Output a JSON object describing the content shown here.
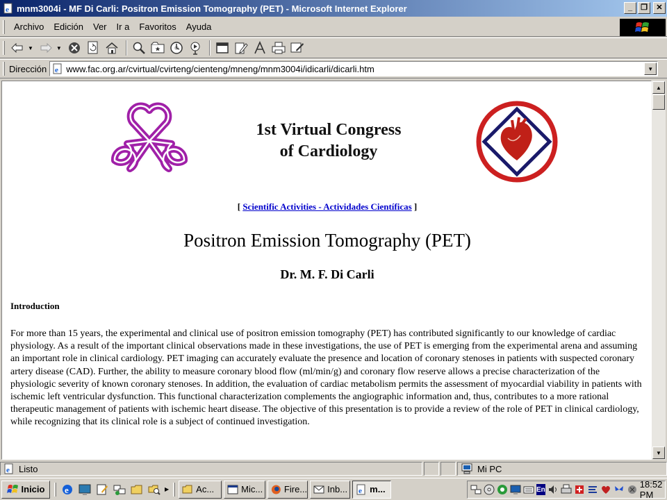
{
  "window": {
    "title": "mnm3004i - MF Di Carli: Positron Emission Tomography (PET) - Microsoft Internet Explorer",
    "buttons": {
      "minimize": "_",
      "maximize": "❐",
      "close": "✕"
    }
  },
  "menu": {
    "items": [
      "Archivo",
      "Edición",
      "Ver",
      "Ir a",
      "Favoritos",
      "Ayuda"
    ]
  },
  "toolbar": {
    "icons": [
      "back-icon",
      "forward-icon",
      "stop-icon",
      "refresh-icon",
      "home-icon",
      "search-icon",
      "favorites-icon",
      "history-icon",
      "media-icon",
      "fullscreen-icon",
      "edit-icon",
      "mail-icon",
      "print-icon",
      "discuss-icon"
    ]
  },
  "address": {
    "label": "Dirección",
    "url": "www.fac.org.ar/cvirtual/cvirteng/cienteng/mneng/mnm3004i/idicarli/dicarli.htm"
  },
  "page": {
    "congress_title_line1": "1st Virtual Congress",
    "congress_title_line2": "of Cardiology",
    "nav_prefix": "[",
    "nav_link": "Scientific Activities - Actividades Científicas",
    "nav_suffix": "]",
    "title": "Positron Emission Tomography (PET)",
    "author": "Dr. M. F. Di Carli",
    "section_heading": "Introduction",
    "paragraph": "For more than 15 years, the experimental and clinical use of positron emission tomography (PET) has contributed significantly to our knowledge of cardiac physiology. As a result of the important clinical observations made in these investigations, the use of PET is emerging from the experimental arena and assuming an important role in clinical cardiology. PET imaging can accurately evaluate the presence and location of coronary stenoses in patients with suspected coronary artery disease (CAD). Further, the ability to measure coronary blood flow (ml/min/g) and coronary flow reserve allows a precise characterization of the physiologic severity of known coronary stenoses. In addition, the evaluation of cardiac metabolism permits the assessment of myocardial viability in patients with ischemic left ventricular dysfunction. This functional characterization complements the angiographic information and, thus, contributes to a more rational therapeutic management of patients with ischemic heart disease. The objective of this presentation is to provide a review of the role of PET in clinical cardiology, while recognizing that its clinical role is a subject of continued investigation."
  },
  "status": {
    "text": "Listo",
    "zone": "Mi PC"
  },
  "taskbar": {
    "start": "Inicio",
    "tasks": [
      "Ac...",
      "Mic...",
      "Fire...",
      "Inb...",
      "m..."
    ],
    "clock": "18:52 PM",
    "language": "En"
  },
  "colors": {
    "link": "#0000cc",
    "logo_purple": "#a020a8",
    "logo_red": "#cc2020",
    "logo_navy": "#1a1a6a"
  }
}
